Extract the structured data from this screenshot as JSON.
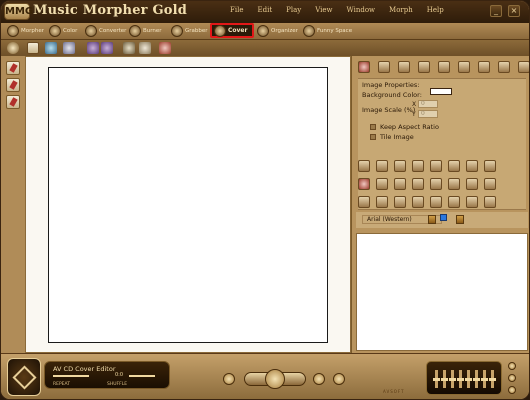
{
  "app": {
    "title": "Music Morpher Gold",
    "logo": "MMG"
  },
  "menu": [
    "File",
    "Edit",
    "Play",
    "View",
    "Window",
    "Morph",
    "Help"
  ],
  "window_controls": {
    "minimize": "_",
    "close": "×"
  },
  "tabs": [
    {
      "label": "Morpher",
      "icon": "morpher-icon"
    },
    {
      "label": "Color",
      "icon": "color-icon"
    },
    {
      "label": "Converter",
      "icon": "converter-icon"
    },
    {
      "label": "Burner",
      "icon": "burner-icon"
    },
    {
      "label": "Grabber",
      "icon": "grabber-icon"
    },
    {
      "label": "Cover",
      "icon": "cover-icon",
      "active": true
    },
    {
      "label": "Organizer",
      "icon": "organizer-icon"
    },
    {
      "label": "Funny Space",
      "icon": "funny-space-icon"
    }
  ],
  "properties": {
    "heading": "Image Properties:",
    "background_color_label": "Background Color:",
    "background_color": "#ffffff",
    "image_scale_label": "Image Scale (%)",
    "x_label": "X",
    "y_label": "Y",
    "x_value": "0",
    "y_value": "0",
    "keep_aspect_label": "Keep Aspect Ratio",
    "tile_image_label": "Tile Image"
  },
  "font": {
    "selected": "Arial (Western)",
    "text_color": "#2a78e0"
  },
  "player": {
    "title": "AV CD Cover Editor",
    "time": "0:0",
    "repeat_label": "REPEAT",
    "shuffle_label": "SHUFFLE",
    "brand": "AVSOFT"
  },
  "colors": {
    "frame": "#c9a874",
    "titlebar": "#3a2410",
    "active_tab_highlight": "#e21818"
  }
}
